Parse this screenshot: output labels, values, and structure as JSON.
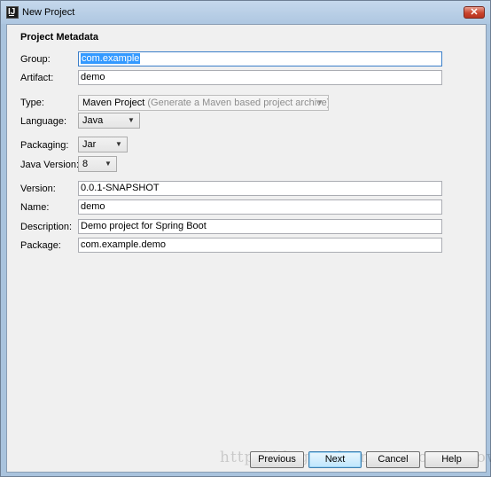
{
  "window": {
    "title": "New Project",
    "close_glyph": "✕"
  },
  "section": {
    "title": "Project Metadata"
  },
  "form": {
    "group": {
      "label": "Group:",
      "value": "com.example"
    },
    "artifact": {
      "label": "Artifact:",
      "value": "demo"
    },
    "type": {
      "label": "Type:",
      "value": "Maven Project",
      "hint": "(Generate a Maven based project archive)"
    },
    "language": {
      "label": "Language:",
      "value": "Java"
    },
    "packaging": {
      "label": "Packaging:",
      "value": "Jar"
    },
    "java_version": {
      "label": "Java Version:",
      "value": "8"
    },
    "version": {
      "label": "Version:",
      "value": "0.0.1-SNAPSHOT"
    },
    "name": {
      "label": "Name:",
      "value": "demo"
    },
    "description": {
      "label": "Description:",
      "value": "Demo project for Spring Boot"
    },
    "package": {
      "label": "Package:",
      "value": "com.example.demo"
    }
  },
  "buttons": {
    "previous": "Previous",
    "next": "Next",
    "cancel": "Cancel",
    "help": "Help"
  },
  "watermark": "http://blog.csdn.net/xiaoyaoyaowu",
  "icons": {
    "app": "intellij-idea-icon",
    "close": "close-icon",
    "dropdown": "chevron-down-icon"
  },
  "colors": {
    "title_bar": "#b9cfe6",
    "close_button": "#c9442d",
    "selection": "#3399ff",
    "dialog_bg": "#f0f0f0"
  }
}
